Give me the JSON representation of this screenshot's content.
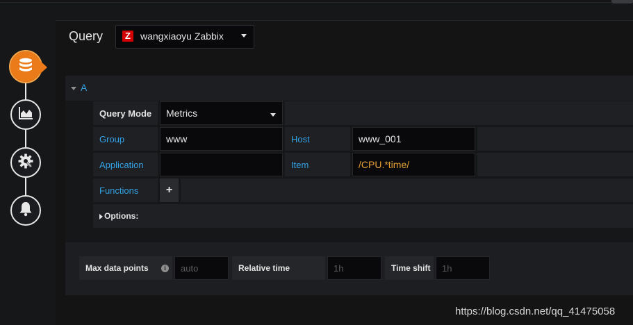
{
  "editor": {
    "title": "Query"
  },
  "datasource": {
    "logo_letter": "Z",
    "name": "wangxiaoyu Zabbix"
  },
  "rail": {
    "items": [
      {
        "name": "queries",
        "icon": "database-icon",
        "active": true
      },
      {
        "name": "visualization",
        "icon": "chart-area-icon",
        "active": false
      },
      {
        "name": "general",
        "icon": "gear-icon",
        "active": false
      },
      {
        "name": "alert",
        "icon": "bell-icon",
        "active": false
      }
    ],
    "active_color": "#eb7b18"
  },
  "query": {
    "ref_id": "A",
    "query_mode_label": "Query Mode",
    "query_mode_value": "Metrics",
    "group_label": "Group",
    "group_value": "www",
    "host_label": "Host",
    "host_value": "www_001",
    "application_label": "Application",
    "application_value": "",
    "item_label": "Item",
    "item_value": "/CPU.*time/",
    "item_value_color": "#e5a136",
    "functions_label": "Functions",
    "functions_add": "+",
    "options_label": "Options:"
  },
  "options": {
    "max_data_points_label": "Max data points",
    "max_data_points_placeholder": "auto",
    "info_icon": "i",
    "relative_time_label": "Relative time",
    "relative_time_placeholder": "1h",
    "time_shift_label": "Time shift",
    "time_shift_placeholder": "1h"
  },
  "watermark": "https://blog.csdn.net/qq_41475058",
  "colors": {
    "label_blue": "#33a2e5",
    "background": "#161719",
    "input_bg": "#09090b"
  }
}
